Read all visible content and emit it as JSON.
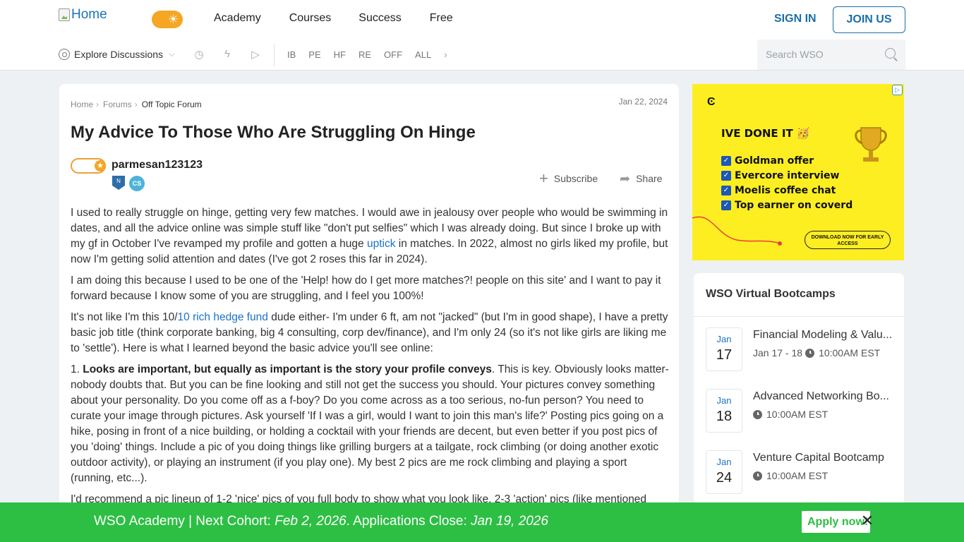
{
  "header": {
    "logo_alt": "Home",
    "nav": [
      "Academy",
      "Courses",
      "Success",
      "Free"
    ],
    "sign_in": "SIGN IN",
    "join_us": "JOIN US"
  },
  "subnav": {
    "explore": "Explore Discussions",
    "icons": [
      "history-icon",
      "bolt-icon",
      "video-icon"
    ],
    "categories": [
      "IB",
      "PE",
      "HF",
      "RE",
      "OFF",
      "ALL"
    ],
    "search_placeholder": "Search WSO"
  },
  "article": {
    "breadcrumbs": [
      "Home",
      "Forums",
      "Off Topic Forum"
    ],
    "date": "Jan 22, 2024",
    "title": "My Advice To Those Who Are Struggling On Hinge",
    "author": "parmesan123123",
    "badge_cs": "CS",
    "subscribe": "Subscribe",
    "share": "Share",
    "p1_a": "I used to really struggle on hinge, getting very few matches. I would awe in jealousy over people who would be swimming in dates, and all the advice online was simple stuff like \"don't put selfies\" which I was already doing. But since I broke up with my gf in October I've revamped my profile and gotten a huge ",
    "p1_link": "uptick",
    "p1_b": " in matches. In 2022, almost no girls liked my profile, but now I'm getting solid attention and dates (I've got 2 roses this far in 2024).",
    "p2": "I am doing this because I used to be one of the 'Help! how do I get more matches?! people on this site' and I want to pay it forward because I know some of you are struggling, and I feel you 100%!",
    "p3_a": "It's not like I'm this 10/",
    "p3_link": "10 rich hedge fund",
    "p3_b": " dude either- I'm under 6 ft, am not \"jacked\" (but I'm in good shape), I have a pretty basic job title (think corporate banking, big 4 consulting, corp dev/finance), and I'm only 24 (so it's not like girls are liking me to 'settle').  Here is what I learned beyond the basic advice you'll see online:",
    "p4_num": "1. ",
    "p4_bold": "Looks are important, but equally as important is the story your profile conveys",
    "p4_rest": ". This is key. Obviously looks matter- nobody doubts that. But you can be fine looking and still not get the success you should. Your pictures convey something about your personality. Do you come off as a f-boy? Do you come across as a too serious, no-fun person? You need to curate your image through pictures. Ask yourself 'If I was a girl, would I want to join this man's life?' Posting pics going on a hike, posing in front of a nice building, or holding a cocktail with your friends are decent, but even better if you post pics of you 'doing' things. Include a pic of you doing things like grilling burgers at a tailgate, rock climbing (or doing another exotic outdoor activity), or playing an instrument (if you play one). My best 2 pics are me rock climbing and playing a sport (running, etc...).",
    "p5": "I'd recommend a pic lineup of 1-2 'nice' pics of you full body to show what you look like, 2-3 'action' pics (like mentioned"
  },
  "ad": {
    "info": "▷",
    "headline": "IVE DONE IT 🥳",
    "items": [
      "Goldman offer",
      "Evercore interview",
      "Moelis coffee chat",
      "Top earner on coverd"
    ],
    "cta": "DOWNLOAD NOW FOR EARLY ACCESS"
  },
  "bootcamps": {
    "heading": "WSO Virtual Bootcamps",
    "events": [
      {
        "month": "Jan",
        "day": "17",
        "name": "Financial Modeling & Valu...",
        "range": "Jan 17 - 18",
        "time": "10:00AM EST"
      },
      {
        "month": "Jan",
        "day": "18",
        "name": "Advanced Networking Bo...",
        "range": "",
        "time": "10:00AM EST"
      },
      {
        "month": "Jan",
        "day": "24",
        "name": "Venture Capital Bootcamp",
        "range": "",
        "time": "10:00AM EST"
      }
    ]
  },
  "banner": {
    "lead": "WSO Academy | Next Cohort: ",
    "cohort_date": "Feb 2, 2026",
    "mid": ". Applications Close: ",
    "close_date": "Jan 19, 2026",
    "apply": "Apply now!"
  }
}
